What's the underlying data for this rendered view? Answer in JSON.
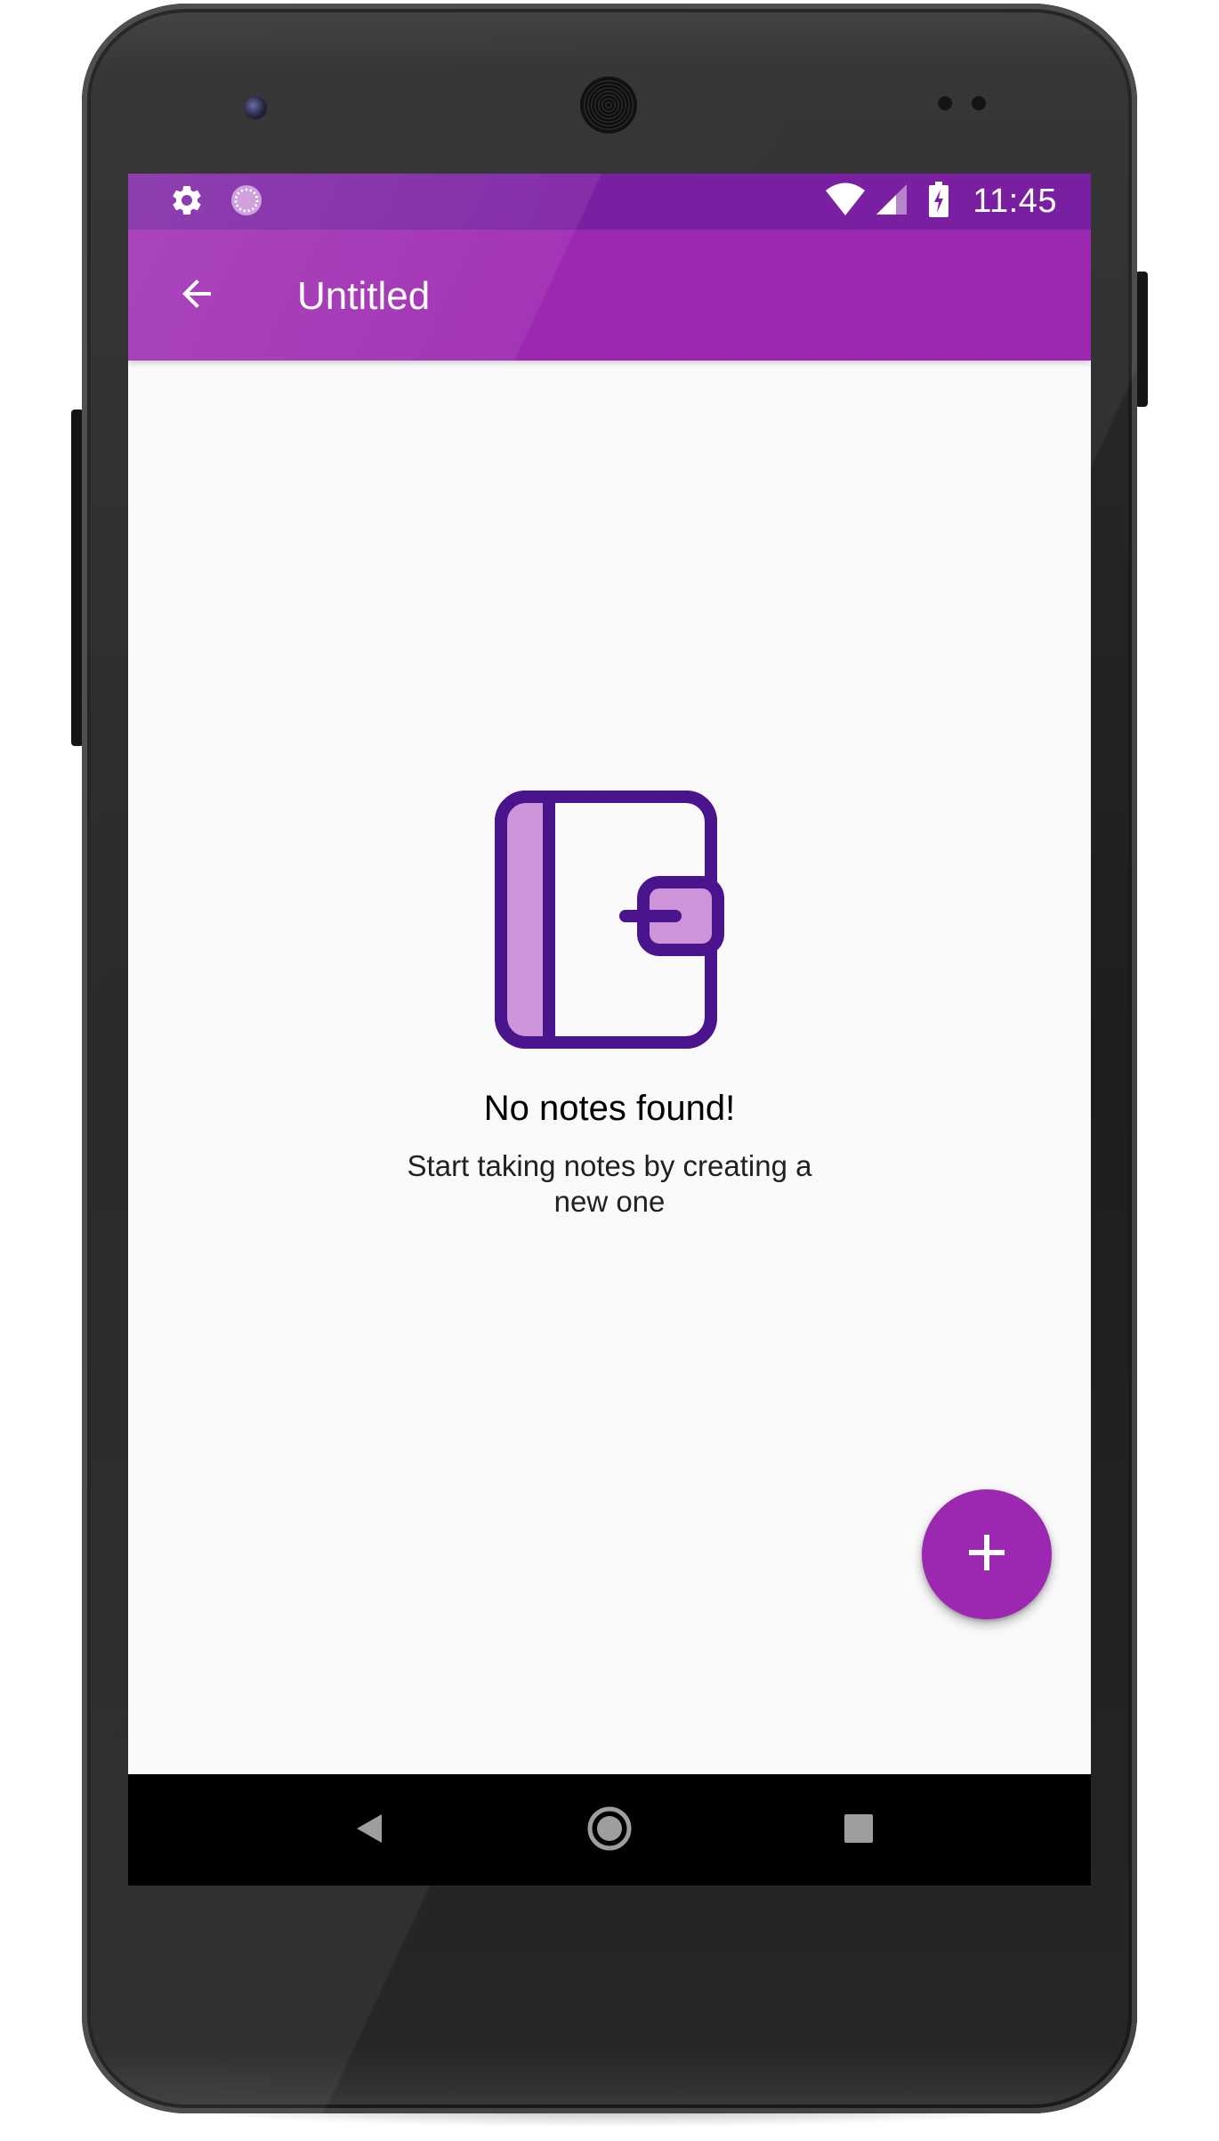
{
  "app_bar": {
    "title": "Untitled",
    "back_icon": "arrow-back-icon"
  },
  "status_bar": {
    "time": "11:45",
    "left_icons": [
      "settings-icon",
      "sync-spinner-icon"
    ],
    "right_icons": [
      "wifi-icon",
      "cell-signal-icon",
      "battery-charging-icon"
    ]
  },
  "empty_state": {
    "icon": "notebook-icon",
    "title": "No notes found!",
    "subtitle": "Start taking notes by creating a new one"
  },
  "fab": {
    "icon": "plus-icon"
  },
  "nav_bar": {
    "buttons": [
      "back-triangle-icon",
      "home-circle-icon",
      "recents-square-icon"
    ]
  },
  "colors": {
    "primary": "#9c27b0",
    "primary_dark": "#7b1fa2",
    "icon_stroke": "#4a148c",
    "icon_fill": "#ce93d8",
    "background": "#fafafa"
  }
}
